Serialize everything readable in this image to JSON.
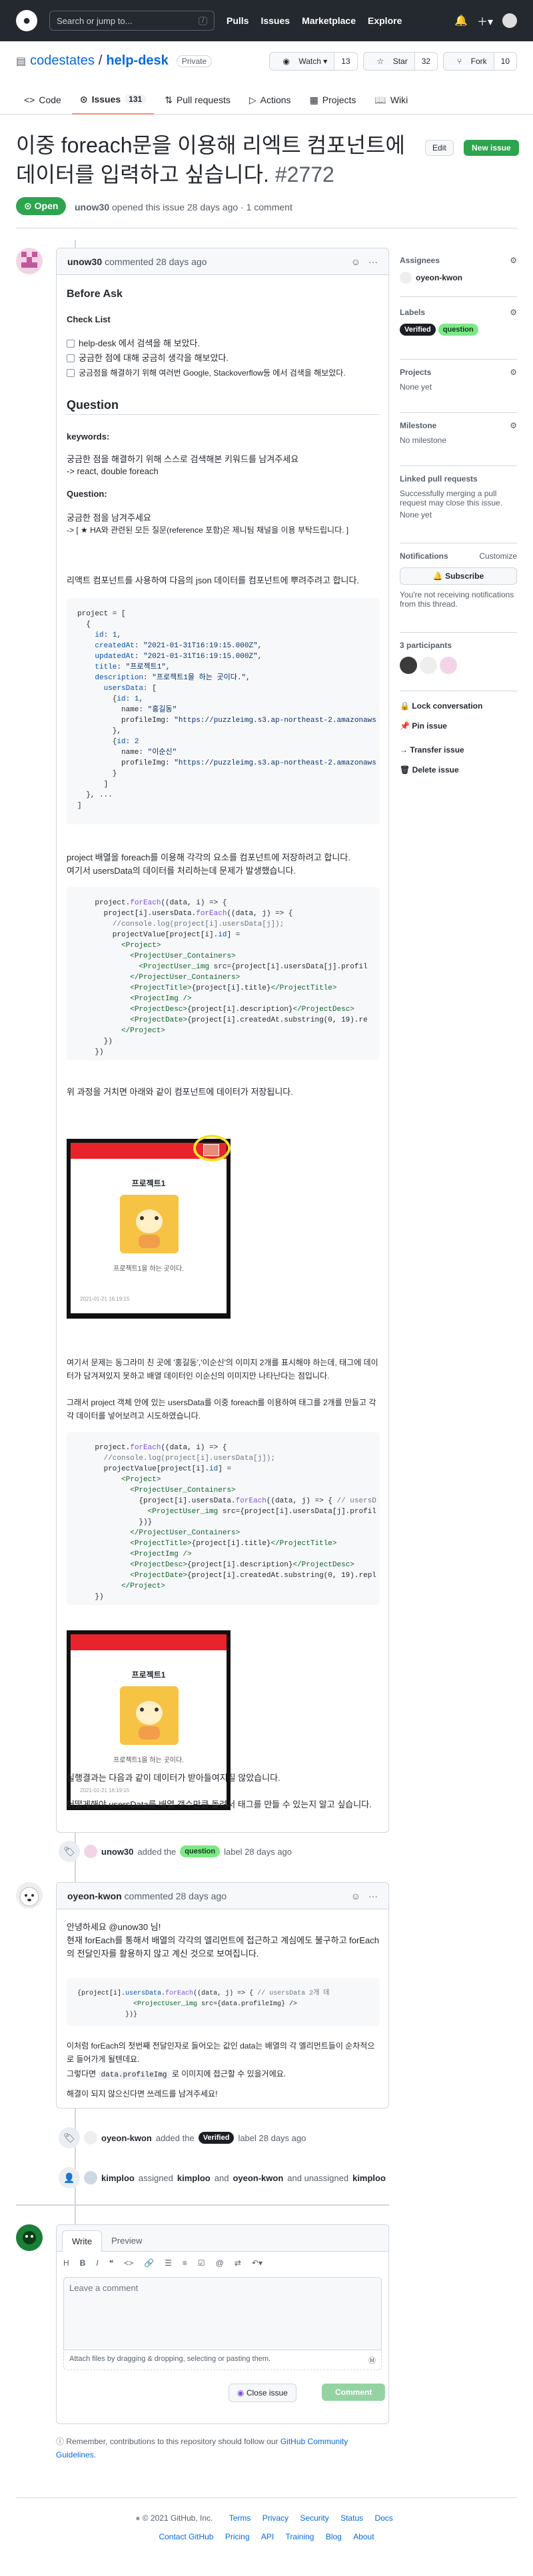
{
  "header": {
    "search_placeholder": "Search or jump to...",
    "search_key": "/",
    "nav": [
      "Pulls",
      "Issues",
      "Marketplace",
      "Explore"
    ]
  },
  "repo": {
    "owner": "codestates",
    "name": "help-desk",
    "visibility": "Private",
    "watch": "Watch",
    "watch_count": "13",
    "star": "Star",
    "star_count": "32",
    "fork": "Fork",
    "fork_count": "10"
  },
  "tabs": [
    {
      "label": "Code"
    },
    {
      "label": "Issues",
      "count": "131"
    },
    {
      "label": "Pull requests"
    },
    {
      "label": "Actions"
    },
    {
      "label": "Projects"
    },
    {
      "label": "Wiki"
    }
  ],
  "issue": {
    "title": "이중 foreach문을 이용해 리엑트 컴포넌트에 데이터를 입력하고 싶습니다.",
    "number": "#2772",
    "edit": "Edit",
    "new_issue": "New issue",
    "state": "Open",
    "meta_user": "unow30",
    "meta_text": "opened this issue 28 days ago · 1 comment"
  },
  "comment1": {
    "author": "unow30",
    "time": "commented 28 days ago",
    "h_before": "Before Ask",
    "checklist_title": "Check List",
    "checks": [
      "help-desk 에서 검색을 해 보았다.",
      "궁금한 점에 대해 궁금히 생각을 해보았다.",
      "궁금점을 해결하기 위해 여러번 Google, Stackoverflow등 에서 검색을 해보았다."
    ],
    "h_question": "Question",
    "keywords_label": "keywords:",
    "kw1": "궁금한 점을 해결하기 위해 스스로 검색해본 키워드를 남겨주세요",
    "kw2": "-> react, double foreach",
    "q_label": "Question:",
    "q1": "궁금한 점을 남겨주세요",
    "q2": "-> [ ★ HA와 관련된 모든 질문(reference 포함)은 제니팀 채널을 이용 부탁드립니다. ]",
    "p1": "리액트 컴포넌트를 사용하여 다음의 json 데이터를 컴포넌트에 뿌려주려고 합니다.",
    "p2": "project 배열을 foreach를 이용해 각각의 요소를 컴포넌트에 저장하려고 합니다.",
    "p3": "여기서 usersData의 데이터를 처리하는데 문제가 발생했습니다.",
    "p4": "위 과정을 거치면 아래와 같이 컴포넌트에 데이터가 저장됩니다.",
    "p5": "여기서 문제는 동그라미 친 곳에 '홍길동','이순신'의 이미지 2개를 표시해야 하는데, 태그에 데이터가 담겨져있지 못하고 배열 데이터인 이순신의 이미지만 나타난다는 점입니다.",
    "p6": "그래서 project 객체 안에 있는 usersData를 이중 foreach를 이용하여 태그를 2개를 만들고 각각 데이터를 넣어보려고 시도하였습니다.",
    "p7": "실행결과는 다음과 같이 데이터가 받아들여지질 않았습니다.",
    "p8": "어떻게해야 usersData를 배열 갯수만큼 돌려서 태그를 만들 수 있는지 알고 싶습니다.",
    "card_title": "프로젝트1",
    "card_desc": "프로젝트1을 하는 곳이다.",
    "card_date": "2021-01-21 16:19:15"
  },
  "event1": {
    "user": "unow30",
    "pre": "added the",
    "label": "question",
    "post": "label 28 days ago"
  },
  "comment2": {
    "author": "oyeon-kwon",
    "time": "commented 28 days ago",
    "l1": "안녕하세요 @unow30 님!",
    "l2": "현재 forEach를 통해서 배열의 각각의 엘리먼트에 접근하고 계심에도 불구하고 forEach의 전달인자를 활용하지 않고 계신 것으로 보여집니다.",
    "l3": "이처럼 forEach의 첫번째 전달인자로 들어오는 값인 data는 배열의 각 엘리먼트들이 순차적으로 들어가게 될텐데요.",
    "l4a": "그렇다면",
    "l4code": "data.profileImg",
    "l4b": "로 이미지에 접근할 수 있을거에요.",
    "l5": "해결이 되지 않으신다면 쓰레드를 남겨주세요!"
  },
  "event2": {
    "user": "oyeon-kwon",
    "pre": "added the",
    "label": "Verified",
    "post": "label 28 days ago"
  },
  "event3": {
    "user": "kimploo",
    "text1": "assigned",
    "user2": "kimploo",
    "text2": "and",
    "user3": "oyeon-kwon",
    "text3": "and unassigned",
    "user4": "kimploo"
  },
  "composer": {
    "tab_write": "Write",
    "tab_preview": "Preview",
    "placeholder": "Leave a comment",
    "attach": "Attach files by dragging & dropping, selecting or pasting them.",
    "close": "Close issue",
    "comment": "Comment",
    "remember": "Remember, contributions to this repository should follow our",
    "guidelines": "GitHub Community Guidelines."
  },
  "sidebar": {
    "assignees": "Assignees",
    "assignee": "oyeon-kwon",
    "labels": "Labels",
    "label1": "Verified",
    "label2": "question",
    "projects": "Projects",
    "projects_v": "None yet",
    "milestone": "Milestone",
    "milestone_v": "No milestone",
    "linked": "Linked pull requests",
    "linked_v": "Successfully merging a pull request may close this issue.",
    "linked_v2": "None yet",
    "notifications": "Notifications",
    "customize": "Customize",
    "subscribe": "Subscribe",
    "notif_v": "You're not receiving notifications from this thread.",
    "participants": "3 participants",
    "lock": "Lock conversation",
    "pin": "Pin issue",
    "transfer": "Transfer issue",
    "delete": "Delete issue"
  },
  "footer": {
    "copy": "© 2021 GitHub, Inc.",
    "links1": [
      "Terms",
      "Privacy",
      "Security",
      "Status",
      "Docs"
    ],
    "links2": [
      "Contact GitHub",
      "Pricing",
      "API",
      "Training",
      "Blog",
      "About"
    ]
  },
  "colors": {
    "open": "#2da44e",
    "verified": "#1b1f24",
    "question": "#7ee787",
    "link": "#0969da"
  }
}
